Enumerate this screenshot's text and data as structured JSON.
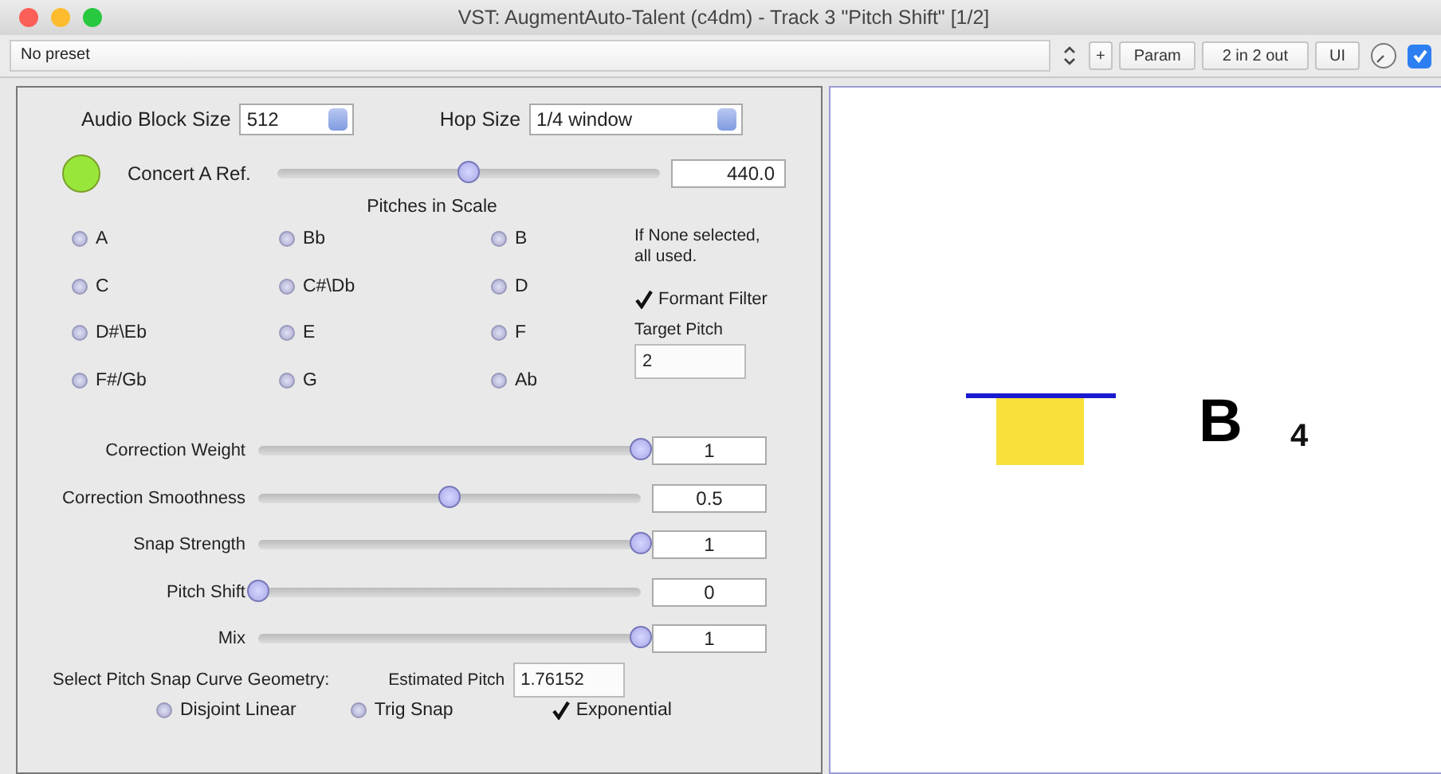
{
  "window": {
    "title": "VST: AugmentAuto-Talent (c4dm) - Track 3 \"Pitch Shift\" [1/2]"
  },
  "toolbar": {
    "preset": "No preset",
    "plus": "+",
    "buttons": [
      "Param",
      "2 in 2 out",
      "UI"
    ],
    "enabled": {
      "checked": true
    }
  },
  "settings": {
    "block_size": {
      "label": "Audio Block Size",
      "value": "512"
    },
    "hop_size": {
      "label": "Hop Size",
      "value": "1/4 window"
    }
  },
  "concert": {
    "label": "Concert A Ref.",
    "level": 0.5,
    "value": "440.0"
  },
  "pitches": {
    "title": "Pitches in Scale",
    "items": [
      {
        "label": "A",
        "selected": false
      },
      {
        "label": "Bb",
        "selected": false
      },
      {
        "label": "B",
        "selected": false
      },
      {
        "label": "C",
        "selected": false
      },
      {
        "label": "C#\\Db",
        "selected": false
      },
      {
        "label": "D",
        "selected": false
      },
      {
        "label": "D#\\Eb",
        "selected": false
      },
      {
        "label": "E",
        "selected": false
      },
      {
        "label": "F",
        "selected": false
      },
      {
        "label": "F#/Gb",
        "selected": false
      },
      {
        "label": "G",
        "selected": false
      },
      {
        "label": "Ab",
        "selected": false
      }
    ],
    "note": "If None selected, all used.",
    "formant_filter": {
      "label": "Formant Filter",
      "checked": true
    },
    "target_pitch": {
      "label": "Target Pitch",
      "value": "2"
    }
  },
  "sliders": [
    {
      "label": "Correction Weight",
      "level": 1,
      "value": "1"
    },
    {
      "label": "Correction Smoothness",
      "level": 0.5,
      "value": "0.5"
    },
    {
      "label": "Snap Strength",
      "level": 1,
      "value": "1"
    },
    {
      "label": "Pitch Shift",
      "level": 0,
      "value": "0"
    },
    {
      "label": "Mix",
      "level": 1,
      "value": "1"
    }
  ],
  "geometry": {
    "label": "Select Pitch Snap Curve Geometry:",
    "estimated_pitch": {
      "label": "Estimated Pitch",
      "value": "1.76152"
    },
    "options": [
      {
        "kind": "radio",
        "label": "Disjoint Linear",
        "selected": false
      },
      {
        "kind": "radio",
        "label": "Trig Snap",
        "selected": false
      },
      {
        "kind": "check",
        "label": "Exponential",
        "selected": true
      }
    ]
  },
  "display": {
    "note": "B",
    "octave": "4"
  }
}
